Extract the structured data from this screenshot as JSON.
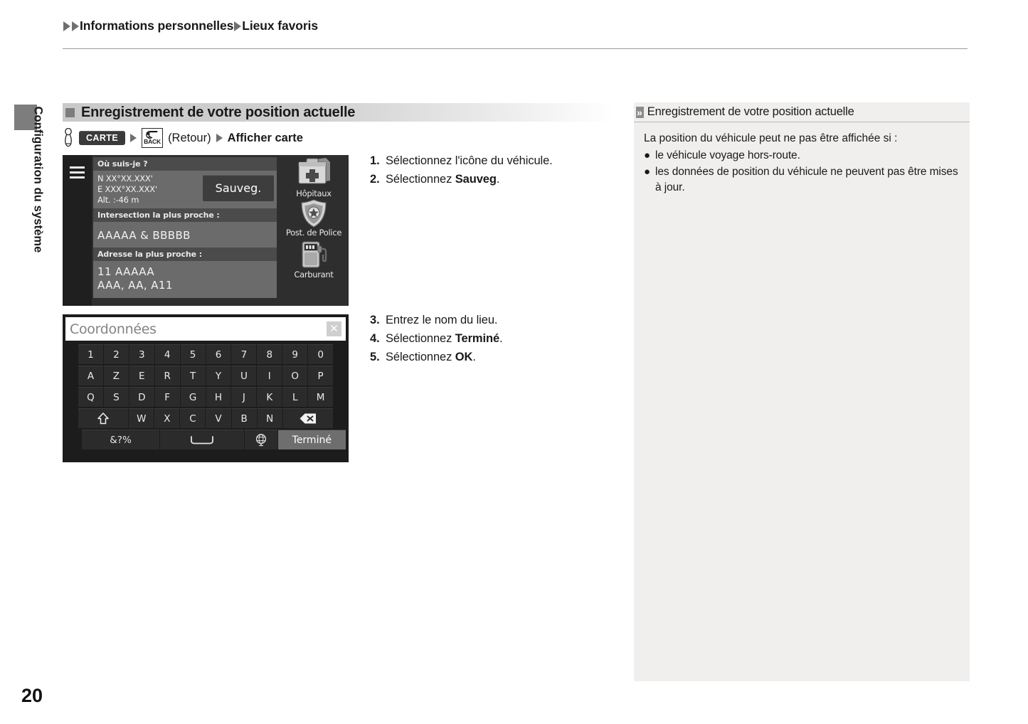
{
  "breadcrumb": {
    "item1": "Informations personnelles",
    "item2": "Lieux favoris"
  },
  "side_tab": {
    "label": "Configuration du système"
  },
  "page_number": "20",
  "section": {
    "title": "Enregistrement de votre position actuelle"
  },
  "nav_path": {
    "hand_icon": "pointing-hand-icon",
    "carte_button": "CARTE",
    "back_button_label": "BACK",
    "retour_text": "(Retour)",
    "final": "Afficher carte"
  },
  "nav_screen": {
    "menu_icon": "hamburger-menu-icon",
    "header": "Où suis-je ?",
    "coord_north": "N XX°XX.XXX'",
    "coord_east": "E XXX°XX.XXX'",
    "altitude": "Alt. :-46 m",
    "save_button": "Sauveg.",
    "intersection_label": "Intersection la plus proche :",
    "intersection_value": "AAAAA & BBBBB",
    "address_label": "Adresse la plus proche :",
    "address_line1": "11 AAAAA",
    "address_line2": "AAA, AA, A11",
    "poi": [
      {
        "icon": "medical-kit-icon",
        "label": "Hôpitaux"
      },
      {
        "icon": "police-badge-icon",
        "label": "Post. de Police"
      },
      {
        "icon": "fuel-pump-icon",
        "label": "Carburant"
      }
    ]
  },
  "keyboard": {
    "placeholder": "Coordonnées",
    "clear_icon": "close-icon",
    "row_numbers": [
      "1",
      "2",
      "3",
      "4",
      "5",
      "6",
      "7",
      "8",
      "9",
      "0"
    ],
    "row_top": [
      "A",
      "Z",
      "E",
      "R",
      "T",
      "Y",
      "U",
      "I",
      "O",
      "P"
    ],
    "row_home": [
      "Q",
      "S",
      "D",
      "F",
      "G",
      "H",
      "J",
      "K",
      "L",
      "M"
    ],
    "row_bottom": [
      "W",
      "X",
      "C",
      "V",
      "B",
      "N"
    ],
    "shift_icon": "shift-up-arrow-icon",
    "backspace_icon": "backspace-icon",
    "symbols_key": "&?%",
    "space_icon": "space-bar-icon",
    "globe_icon": "globe-language-icon",
    "done_key": "Terminé"
  },
  "steps_group_1": [
    {
      "num": "1.",
      "pre": "Sélectionnez l'icône du véhicule.",
      "bold": "",
      "post": ""
    },
    {
      "num": "2.",
      "pre": "Sélectionnez ",
      "bold": "Sauveg",
      "post": "."
    }
  ],
  "steps_group_2": [
    {
      "num": "3.",
      "pre": "Entrez le nom du lieu.",
      "bold": "",
      "post": ""
    },
    {
      "num": "4.",
      "pre": "Sélectionnez ",
      "bold": "Terminé",
      "post": "."
    },
    {
      "num": "5.",
      "pre": "Sélectionnez ",
      "bold": "OK",
      "post": "."
    }
  ],
  "note": {
    "chevrons": "»",
    "title": "Enregistrement de votre position actuelle",
    "intro": "La position du véhicule peut ne pas être affichée si :",
    "bullets": [
      "le véhicule voyage hors-route.",
      "les données de position du véhicule ne peuvent pas être mises à jour."
    ]
  },
  "colors": {
    "page_bg": "#ffffff",
    "note_bg": "#f0efed",
    "section_gray": "#c9c9c9",
    "tab_gray": "#7d7d7d",
    "device_dark": "#1c1c1c",
    "panel_gray": "#6b6b6b"
  }
}
